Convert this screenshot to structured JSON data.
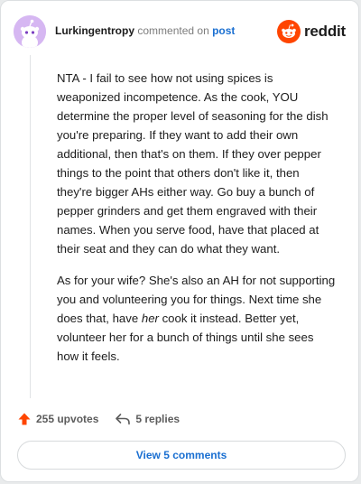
{
  "header": {
    "username": "Lurkingentropy",
    "action_text": "commented on",
    "post_link": "post",
    "logo_text": "reddit"
  },
  "comment": {
    "p1": "NTA - I fail to see how not using spices is weaponized incompetence. As the cook, YOU determine the proper level of seasoning for the dish you're preparing. If they want to add their own additional, then that's on them. If they over pepper things to the point that others don't like it, then they're bigger AHs either way. Go buy a bunch of pepper grinders and get them engraved with their names. When you serve food, have that placed at their seat and they can do what they want.",
    "p2_before": "As for your wife? She's also an AH for not supporting you and volunteering you for things. Next time she does that, have ",
    "p2_em": "her",
    "p2_after": " cook it instead. Better yet, volunteer her for a bunch of things until she sees how it feels."
  },
  "actions": {
    "upvotes": "255 upvotes",
    "replies": "5 replies"
  },
  "footer": {
    "view_comments": "View 5 comments"
  },
  "colors": {
    "accent_blue": "#1a6fd1",
    "reddit_orange": "#ff4500",
    "avatar_bg": "#d6b7f2"
  },
  "icons": {
    "avatar": "snoo-avatar",
    "logo": "reddit-snoo-icon",
    "upvote": "upvote-arrow-icon",
    "reply": "reply-arrow-icon"
  }
}
